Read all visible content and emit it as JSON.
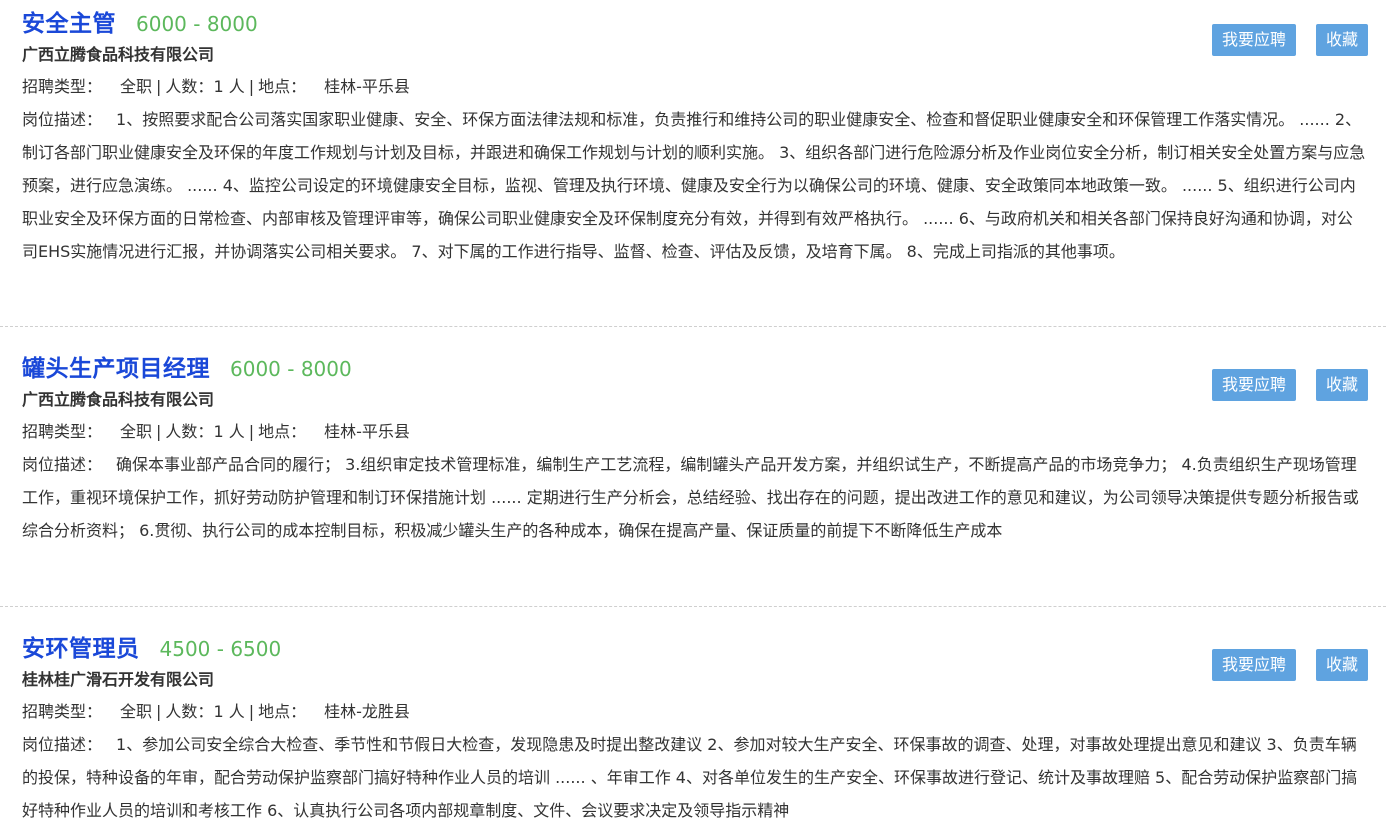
{
  "labels": {
    "type_label": "招聘类型：",
    "count_label": "人数：",
    "location_label": "地点：",
    "desc_label": "岗位描述：",
    "apply_button": "我要应聘",
    "save_button": "收藏",
    "separator": "|"
  },
  "jobs": [
    {
      "title": "安全主管",
      "salary": "6000 - 8000",
      "company": "广西立腾食品科技有限公司",
      "type": "全职",
      "count": "1 人",
      "location": "桂林-平乐县",
      "description": "1、按照要求配合公司落实国家职业健康、安全、环保方面法律法规和标准，负责推行和维持公司的职业健康安全、检查和督促职业健康安全和环保管理工作落实情况。 ...... 2、制订各部门职业健康安全及环保的年度工作规划与计划及目标，并跟进和确保工作规划与计划的顺利实施。 3、组织各部门进行危险源分析及作业岗位安全分析，制订相关安全处置方案与应急预案，进行应急演练。 ...... 4、监控公司设定的环境健康安全目标，监视、管理及执行环境、健康及安全行为以确保公司的环境、健康、安全政策同本地政策一致。 ...... 5、组织进行公司内职业安全及环保方面的日常检查、内部审核及管理评审等，确保公司职业健康安全及环保制度充分有效，并得到有效严格执行。 ...... 6、与政府机关和相关各部门保持良好沟通和协调，对公司EHS实施情况进行汇报，并协调落实公司相关要求。 7、对下属的工作进行指导、监督、检查、评估及反馈，及培育下属。 8、完成上司指派的其他事项。"
    },
    {
      "title": "罐头生产项目经理",
      "salary": "6000 - 8000",
      "company": "广西立腾食品科技有限公司",
      "type": "全职",
      "count": "1 人",
      "location": "桂林-平乐县",
      "description": "确保本事业部产品合同的履行； 3.组织审定技术管理标准，编制生产工艺流程，编制罐头产品开发方案，并组织试生产，不断提高产品的市场竞争力； 4.负责组织生产现场管理工作，重视环境保护工作，抓好劳动防护管理和制订环保措施计划 ...... 定期进行生产分析会，总结经验、找出存在的问题，提出改进工作的意见和建议，为公司领导决策提供专题分析报告或综合分析资料； 6.贯彻、执行公司的成本控制目标，积极减少罐头生产的各种成本，确保在提高产量、保证质量的前提下不断降低生产成本"
    },
    {
      "title": "安环管理员",
      "salary": "4500 - 6500",
      "company": "桂林桂广滑石开发有限公司",
      "type": "全职",
      "count": "1 人",
      "location": "桂林-龙胜县",
      "description": "1、参加公司安全综合大检查、季节性和节假日大检查，发现隐患及时提出整改建议 2、参加对较大生产安全、环保事故的调查、处理，对事故处理提出意见和建议 3、负责车辆的投保，特种设备的年审，配合劳动保护监察部门搞好特种作业人员的培训 ...... 、年审工作 4、对各单位发生的生产安全、环保事故进行登记、统计及事故理赔 5、配合劳动保护监察部门搞好特种作业人员的培训和考核工作 6、认真执行公司各项内部规章制度、文件、会议要求决定及领导指示精神"
    }
  ],
  "colors": {
    "title": "#1a48d8",
    "salary": "#5cb85c",
    "button_bg": "#5fa3e0",
    "text": "#333333",
    "divider": "#cfcfcf"
  }
}
